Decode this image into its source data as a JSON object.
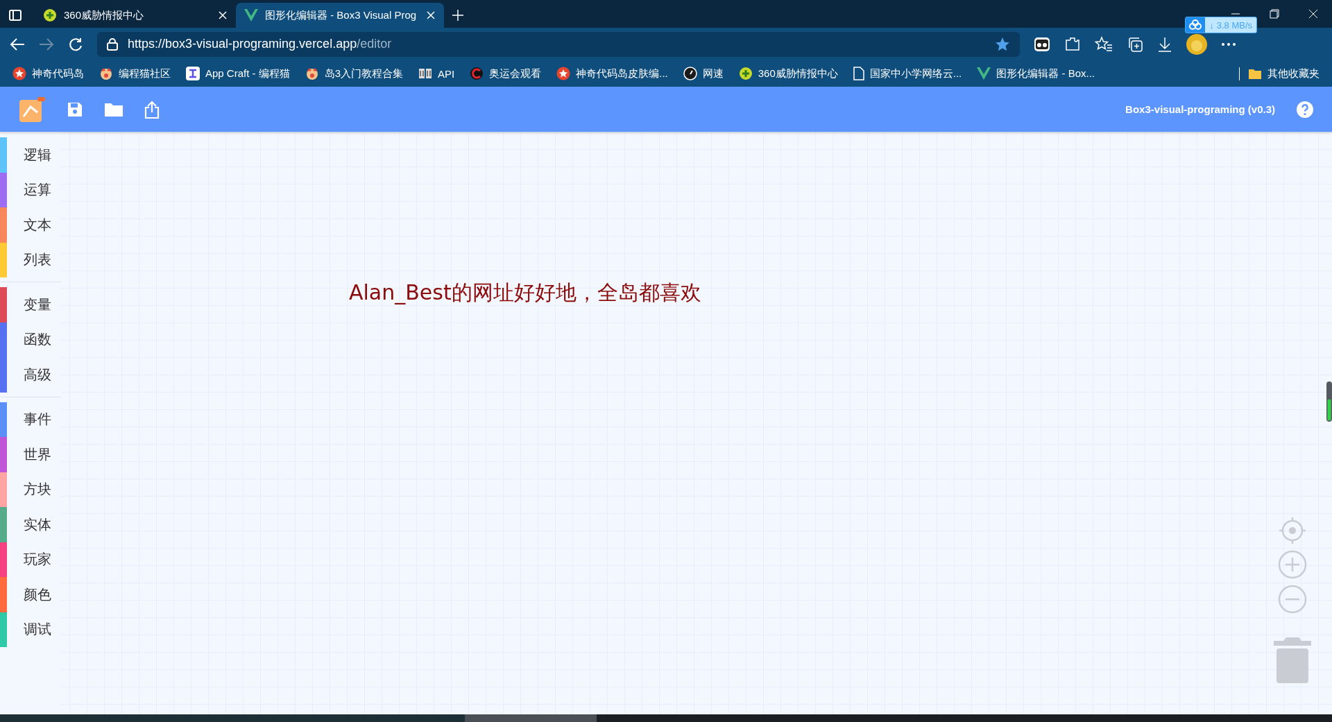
{
  "browser": {
    "tabs": [
      {
        "title": "360威胁情报中心",
        "selected": false,
        "kind": "plus"
      },
      {
        "title": "图形化编辑器 - Box3 Visual Prog",
        "selected": true,
        "kind": "v"
      }
    ],
    "address": {
      "scheme": "https://",
      "host": "box3-visual-programing.vercel.app",
      "path": "/editor"
    },
    "speed_arrow": "↓",
    "speed": "3.8 MB/s",
    "bookmarks": [
      {
        "label": "神奇代码岛",
        "kind": "star"
      },
      {
        "label": "编程猫社区",
        "kind": "cat"
      },
      {
        "label": "App Craft - 编程猫",
        "kind": "app"
      },
      {
        "label": "岛3入门教程合集",
        "kind": "cat"
      },
      {
        "label": "API",
        "kind": "book"
      },
      {
        "label": "奥运会观看",
        "kind": "c"
      },
      {
        "label": "神奇代码岛皮肤编...",
        "kind": "star"
      },
      {
        "label": "网速",
        "kind": "gauge"
      },
      {
        "label": "360威胁情报中心",
        "kind": "plus"
      },
      {
        "label": "国家中小学网络云...",
        "kind": "page"
      },
      {
        "label": "图形化编辑器 - Box...",
        "kind": "v"
      }
    ],
    "other_bookmarks": "其他收藏夹"
  },
  "app": {
    "title": "Box3-visual-programing (v0.3)"
  },
  "sidebar": {
    "groups": [
      {
        "items": [
          {
            "label": "逻辑",
            "color": "#5cc4f8"
          },
          {
            "label": "运算",
            "color": "#9d6cf2"
          },
          {
            "label": "文本",
            "color": "#f8875c"
          },
          {
            "label": "列表",
            "color": "#fdc935"
          }
        ]
      },
      {
        "items": [
          {
            "label": "变量",
            "color": "#df4a58"
          },
          {
            "label": "函数",
            "color": "#5670f0"
          },
          {
            "label": "高级",
            "color": "#5670f0"
          }
        ]
      },
      {
        "items": [
          {
            "label": "事件",
            "color": "#5b8ff8"
          },
          {
            "label": "世界",
            "color": "#c155d8"
          },
          {
            "label": "方块",
            "color": "#ffa3a3"
          },
          {
            "label": "实体",
            "color": "#55ab8a"
          },
          {
            "label": "玩家",
            "color": "#f7407f"
          },
          {
            "label": "颜色",
            "color": "#ff6b3d"
          },
          {
            "label": "调试",
            "color": "#2ec9a8"
          }
        ]
      }
    ]
  },
  "canvas": {
    "message": "Alan_Best的网址好好地，全岛都喜欢"
  }
}
